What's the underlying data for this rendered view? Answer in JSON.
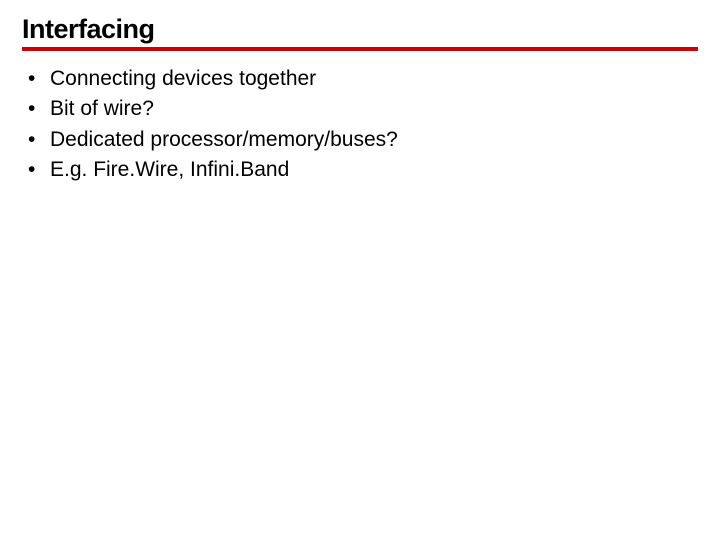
{
  "slide": {
    "title": "Interfacing",
    "bullets": [
      "Connecting devices together",
      "Bit of wire?",
      "Dedicated processor/memory/buses?",
      "E.g. Fire.Wire, Infini.Band"
    ]
  }
}
